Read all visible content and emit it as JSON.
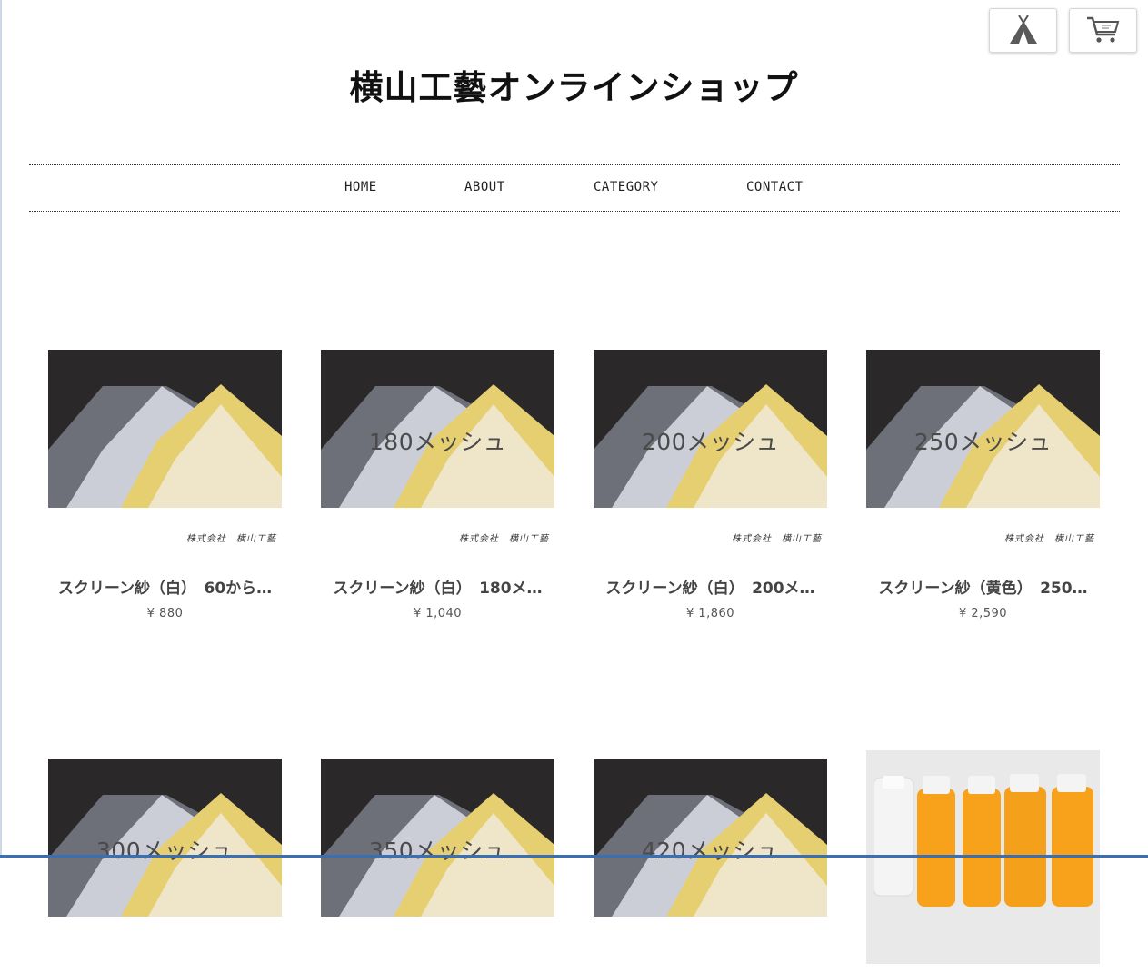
{
  "header": {
    "title": "横山工藝オンラインショップ",
    "home_icon": "tent-icon",
    "cart_icon": "cart-icon"
  },
  "nav": {
    "home": "HOME",
    "about": "ABOUT",
    "category": "CATEGORY",
    "contact": "CONTACT"
  },
  "products": [
    {
      "name": "スクリーン紗（白）　60から…",
      "price": "¥ 880",
      "image_label": "",
      "maker_mark": "株式会社　横山工藝"
    },
    {
      "name": "スクリーン紗（白）　180メ…",
      "price": "¥ 1,040",
      "image_label": "180メッシュ",
      "maker_mark": "株式会社　横山工藝"
    },
    {
      "name": "スクリーン紗（白）　200メ…",
      "price": "¥ 1,860",
      "image_label": "200メッシュ",
      "maker_mark": "株式会社　横山工藝"
    },
    {
      "name": "スクリーン紗（黄色）　250…",
      "price": "¥ 2,590",
      "image_label": "250メッシュ",
      "maker_mark": "株式会社　横山工藝"
    },
    {
      "name": "",
      "price": "",
      "image_label": "300メッシュ"
    },
    {
      "name": "",
      "price": "",
      "image_label": "350メッシュ"
    },
    {
      "name": "",
      "price": "",
      "image_label": "420メッシュ"
    },
    {
      "name": "",
      "price": "",
      "image_label": ""
    }
  ],
  "colors": {
    "photo_bg": "#2a2829",
    "fabric_gray": "#7d8088",
    "fabric_white": "#cfd2da",
    "fabric_yellow": "#e8d27a",
    "fabric_cream": "#efe6cc",
    "ink_orange": "#f7a21a",
    "accent_bar": "#3b6fb3"
  }
}
